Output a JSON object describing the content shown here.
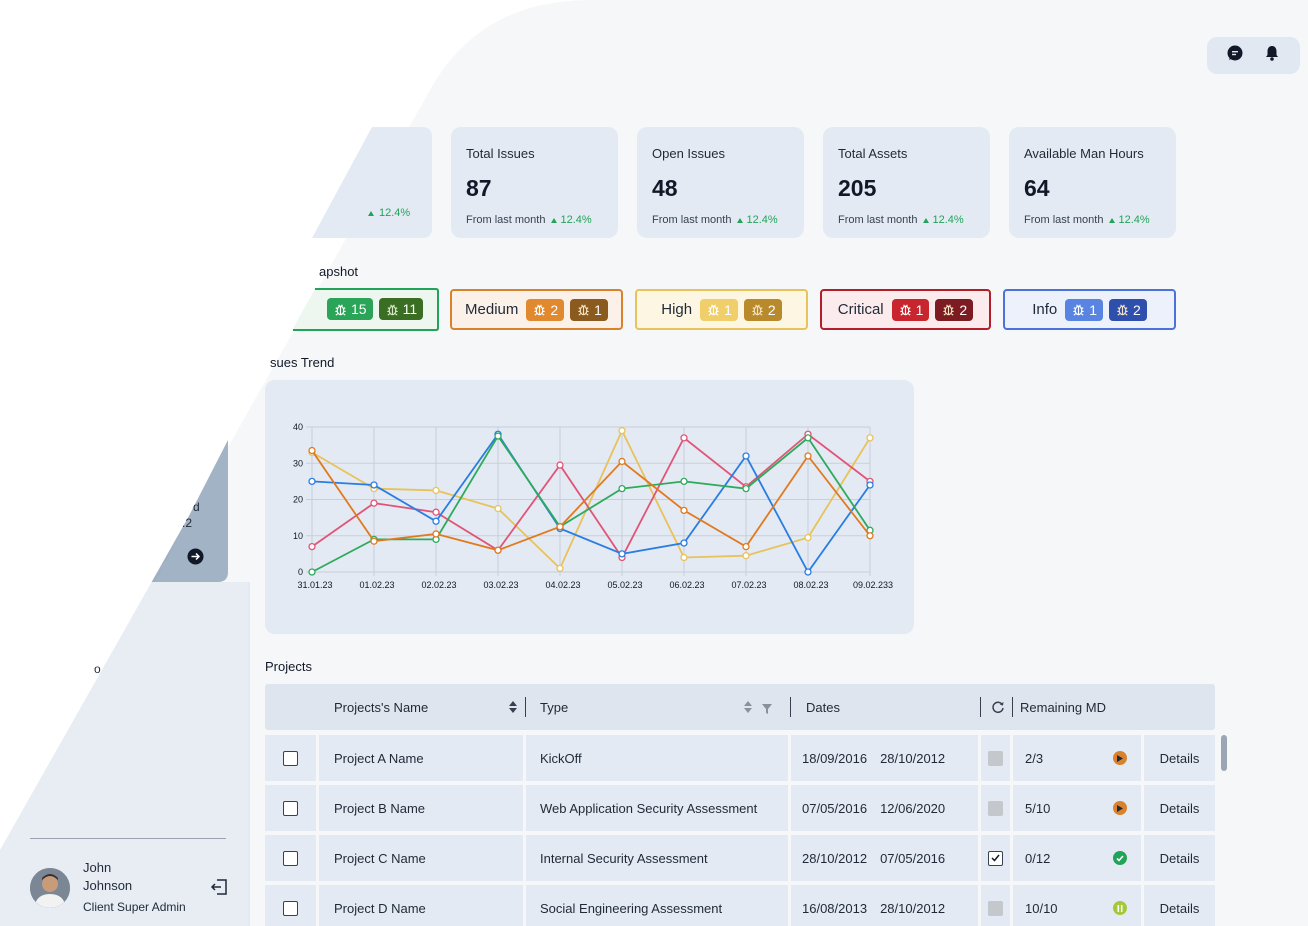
{
  "stats": [
    {
      "title": "Total Issues",
      "value": "87",
      "from": "From last month",
      "change": "12.4%"
    },
    {
      "title": "Open Issues",
      "value": "48",
      "from": "From last month",
      "change": "12.4%"
    },
    {
      "title": "Total Assets",
      "value": "205",
      "from": "From last month",
      "change": "12.4%"
    },
    {
      "title": "Available Man Hours",
      "value": "64",
      "from": "From last month",
      "change": "12.4%"
    }
  ],
  "partial_stat_change": "12.4%",
  "snapshot_title": "apshot",
  "severity": [
    {
      "label": "",
      "open": "15",
      "closed": "11",
      "color": "#22a35a"
    },
    {
      "label": "Medium",
      "open": "2",
      "closed": "1",
      "color": "#d9822b"
    },
    {
      "label": "High",
      "open": "1",
      "closed": "2",
      "color": "#e8c25a"
    },
    {
      "label": "Critical",
      "open": "1",
      "closed": "2",
      "color": "#b31d2a"
    },
    {
      "label": "Info",
      "open": "1",
      "closed": "2",
      "color": "#4a72d8"
    }
  ],
  "trend_title": "sues Trend",
  "chart_data": {
    "type": "line",
    "categories": [
      "31.01.23",
      "01.02.23",
      "02.02.23",
      "03.02.23",
      "04.02.23",
      "05.02.23",
      "06.02.23",
      "07.02.23",
      "08.02.23",
      "09.02.233"
    ],
    "ylim": [
      0,
      40
    ],
    "yticks": [
      0,
      10,
      20,
      30,
      40
    ],
    "grid": true,
    "series": [
      {
        "color": "#e8c25a",
        "values": [
          33,
          23,
          22.5,
          17.5,
          1,
          39,
          4,
          4.5,
          9.5,
          37
        ]
      },
      {
        "color": "#e05577",
        "values": [
          7,
          19,
          16.5,
          6,
          29.5,
          4,
          37,
          23.5,
          38,
          25
        ]
      },
      {
        "color": "#2a7de1",
        "values": [
          25,
          24,
          14,
          38,
          12,
          5,
          8,
          32,
          0,
          24
        ]
      },
      {
        "color": "#2eaa5c",
        "values": [
          0,
          9,
          9,
          37.5,
          12.5,
          23,
          25,
          23,
          37,
          11.5
        ]
      },
      {
        "color": "#e07a1f",
        "values": [
          33.5,
          8.5,
          10.5,
          6,
          12.5,
          30.5,
          17,
          7,
          32,
          10
        ]
      }
    ]
  },
  "projects_title": "Projects",
  "table": {
    "headers": {
      "name": "Projects's  Name",
      "type": "Type",
      "dates": "Dates",
      "remaining": "Remaining MD"
    },
    "rows": [
      {
        "name": "Project A Name",
        "type": "KickOff",
        "start": "18/09/2016",
        "end": "28/10/2012",
        "done": false,
        "remaining": "2/3",
        "status": "play",
        "status_color": "#d9822b",
        "action": "Details"
      },
      {
        "name": "Project B Name",
        "type": "Web Application Security Assessment",
        "start": "07/05/2016",
        "end": "12/06/2020",
        "done": false,
        "remaining": "5/10",
        "status": "play",
        "status_color": "#d9822b",
        "action": "Details"
      },
      {
        "name": "Project C Name",
        "type": "Internal Security Assessment",
        "start": "28/10/2012",
        "end": "07/05/2016",
        "done": true,
        "remaining": "0/12",
        "status": "check",
        "status_color": "#22a35a",
        "action": "Details"
      },
      {
        "name": "Project D Name",
        "type": "Social Engineering Assessment",
        "start": "16/08/2013",
        "end": "28/10/2012",
        "done": false,
        "remaining": "10/10",
        "status": "pause",
        "status_color": "#a3c93a",
        "action": "Details"
      }
    ]
  },
  "sidebar_fragments": {
    "a": "d",
    "b": ".2",
    "c": "o"
  },
  "user": {
    "first": "John",
    "last": "Johnson",
    "role": "Client Super Admin"
  }
}
